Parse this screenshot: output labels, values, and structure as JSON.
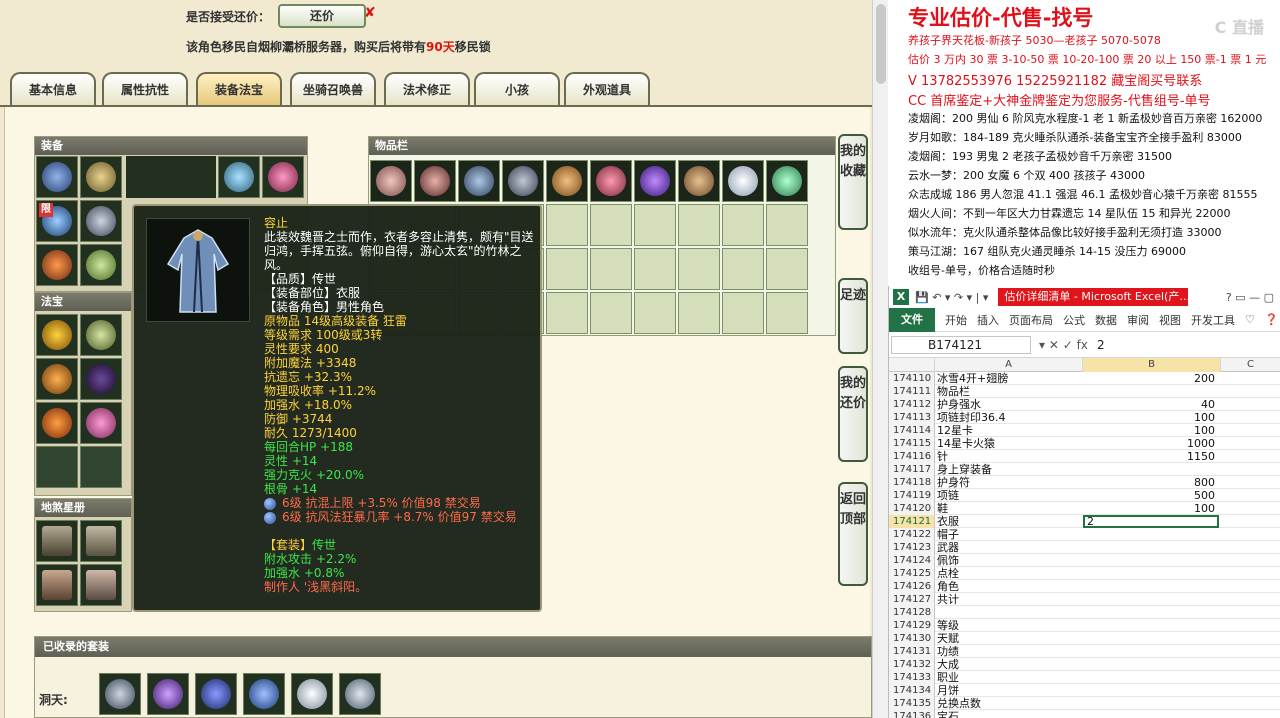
{
  "game": {
    "offer_label": "是否接受还价：",
    "offer_button": "还价",
    "offer_x": "✘",
    "migrate_prefix": "该角色移民自烟柳灞桥服务器，购买后将带有",
    "migrate_days": "90天",
    "migrate_suffix": "移民锁",
    "tabs": [
      "基本信息",
      "属性抗性",
      "装备法宝",
      "坐骑召唤兽",
      "法术修正",
      "小孩",
      "外观道具"
    ],
    "equip_title": "装备",
    "bag_title": "物品栏",
    "fabao_title": "法宝",
    "disha_title": "地煞星册",
    "limit_badge": "限",
    "suit_title": "已收录的套装",
    "dongtian_label": "洞天:",
    "side_buttons": [
      "我的收藏",
      "足迹",
      "我的还价",
      "返回顶部"
    ]
  },
  "tooltip": {
    "name": "容止",
    "desc": "此装效魏晋之士而作，衣者多容止清隽，颇有\"目送归鸿，手挥五弦。俯仰自得，游心太玄\"的竹林之风。",
    "quality": "【品质】传世",
    "slot": "【装备部位】衣服",
    "role": "【装备角色】男性角色",
    "base_line": "原物品 14级高级装备 狂雷",
    "req_level": "等级需求 100级或3转",
    "spirit_req": "灵性要求 400",
    "magic": "附加魔法 +3348",
    "anti_forget": "抗遗忘 +32.3%",
    "phys_absorb": "物理吸收率 +11.2%",
    "water_boost": "加强水 +18.0%",
    "defense": "防御 +3744",
    "durability": "耐久 1273/1400",
    "hp_regen": "每回合HP +188",
    "spirit": "灵性 +14",
    "force_ke_water": "强力克火 +20.0%",
    "bone": "根骨 +14",
    "gem1": "6级 抗混上限 +3.5% 价值98 禁交易",
    "gem2": "6级 抗风法狂暴几率 +8.7% 价值97 禁交易",
    "set_label": "【套装】",
    "set_name": "传世",
    "set_attr1": "附水攻击 +2.2%",
    "set_attr2": "加强水 +0.8%",
    "maker": "制作人 '浅黑斜阳。"
  },
  "notes": {
    "title": "专业估价-代售-找号",
    "lines_red": [
      "养孩子界天花板-新孩子 5030—老孩子 5070-5078",
      "估价 3 万内 30 票  3-10-50 票  10-20-100 票  20 以上 150 票-1 票 1 元"
    ],
    "phone": "V 13782553976    15225921182   藏宝阁买号联系",
    "cc": "CC 首席鉴定+大神金牌鉴定为您服务-代售组号-单号",
    "lines": [
      "凌烟阁：200 男仙 6 阶风克水程度-1 老 1 新孟极妙音百万亲密 162000",
      "岁月如歌：184-189 克火睡杀队通杀-装备宝宝齐全接手盈利 83000",
      "凌烟阁：193 男鬼 2 老孩子孟极妙音千万亲密 31500",
      "云水一梦：200 女魔 6 个双 400 孩孩子 43000",
      "众志成城 186 男人忽混 41.1 强混 46.1 孟极妙音心猿千万亲密 81555",
      "烟火人间：不到一年区大力甘霖遗忘 14 星队伍 15 和异光 22000",
      "似水流年：克火队通杀整体品像比较好接手盈利无须打造 33000",
      "策马江湖：167 组队克火通灵睡杀 14-15 没压力 69000",
      "收组号-单号，价格合适随时秒"
    ],
    "watermark": "C 直播"
  },
  "excel": {
    "logo": "X",
    "quick_access": "💾 ↶ ▾ ↷ ▾ | ▾",
    "doc_title": "估价详细清单 - Microsoft Excel(产...",
    "win_buttons": "?  ▭  —  ▢",
    "menu": [
      "开始",
      "插入",
      "页面布局",
      "公式",
      "数据",
      "审阅",
      "视图",
      "开发工具",
      "♡",
      "❓"
    ],
    "file_tab": "文件",
    "name_box": "B174121",
    "formula_icons": "▾  ✕  ✓  fx",
    "formula_value": "2",
    "cols": [
      "",
      "A",
      "B",
      "C"
    ],
    "rows": [
      {
        "n": "174110",
        "a": "冰雪4开+翅膀",
        "b": "200"
      },
      {
        "n": "174111",
        "a": "物品栏",
        "b": ""
      },
      {
        "n": "174112",
        "a": "护身强水",
        "b": "40"
      },
      {
        "n": "174113",
        "a": "项链封印36.4",
        "b": "100"
      },
      {
        "n": "174114",
        "a": "12星卡",
        "b": "100"
      },
      {
        "n": "174115",
        "a": "14星卡火猿",
        "b": "1000"
      },
      {
        "n": "174116",
        "a": "针",
        "b": "1150"
      },
      {
        "n": "174117",
        "a": "身上穿装备",
        "b": ""
      },
      {
        "n": "174118",
        "a": "护身符",
        "b": "800"
      },
      {
        "n": "174119",
        "a": "项链",
        "b": "500"
      },
      {
        "n": "174120",
        "a": "鞋",
        "b": "100"
      },
      {
        "n": "174121",
        "a": "衣服",
        "b": "2"
      },
      {
        "n": "174122",
        "a": "帽子",
        "b": ""
      },
      {
        "n": "174123",
        "a": "武器",
        "b": ""
      },
      {
        "n": "174124",
        "a": "佩饰",
        "b": ""
      },
      {
        "n": "174125",
        "a": "点栓",
        "b": ""
      },
      {
        "n": "174126",
        "a": "角色",
        "b": ""
      },
      {
        "n": "174127",
        "a": "共计",
        "b": ""
      },
      {
        "n": "174128",
        "a": "",
        "b": ""
      },
      {
        "n": "174129",
        "a": "等级",
        "b": ""
      },
      {
        "n": "174130",
        "a": "天赋",
        "b": ""
      },
      {
        "n": "174131",
        "a": "功绩",
        "b": ""
      },
      {
        "n": "174132",
        "a": "大成",
        "b": ""
      },
      {
        "n": "174133",
        "a": "职业",
        "b": ""
      },
      {
        "n": "174134",
        "a": "月饼",
        "b": ""
      },
      {
        "n": "174135",
        "a": "兑换点数",
        "b": ""
      },
      {
        "n": "174136",
        "a": "宝石",
        "b": ""
      }
    ]
  }
}
